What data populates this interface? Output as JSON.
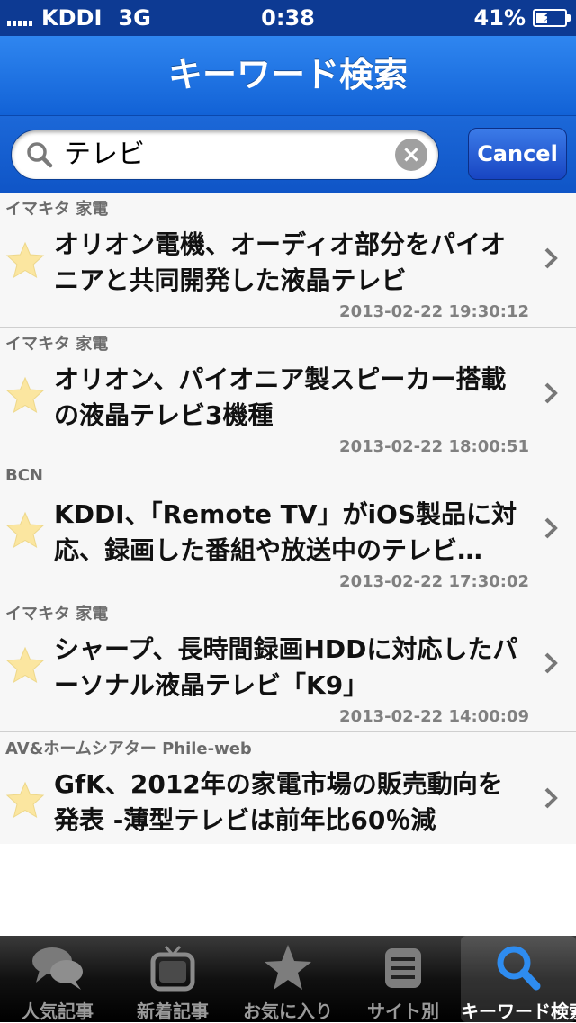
{
  "status": {
    "carrier": "KDDI",
    "network": "3G",
    "time": "0:38",
    "battery": "41%",
    "battery_level": 0.41
  },
  "nav": {
    "title": "キーワード検索"
  },
  "search": {
    "value": "テレビ",
    "cancel_label": "Cancel"
  },
  "articles": [
    {
      "source": "イマキタ 家電",
      "title": "オリオン電機、オーディオ部分をパイオニアと共同開発した液晶テレビ",
      "date": "2013-02-22 19:30:12"
    },
    {
      "source": "イマキタ 家電",
      "title": "オリオン、パイオニア製スピーカー搭載の液晶テレビ3機種",
      "date": "2013-02-22 18:00:51"
    },
    {
      "source": "BCN",
      "title": "KDDI、「Remote TV」がiOS製品に対応、録画した番組や放送中のテレビ…",
      "date": "2013-02-22 17:30:02"
    },
    {
      "source": "イマキタ 家電",
      "title": "シャープ、長時間録画HDDに対応したパーソナル液晶テレビ「K9」",
      "date": "2013-02-22 14:00:09"
    },
    {
      "source": "AV&ホームシアター Phile-web",
      "title": "GfK、2012年の家電市場の販売動向を発表 -薄型テレビは前年比60％減",
      "date": ""
    }
  ],
  "tabs": [
    {
      "label": "人気記事",
      "icon": "speech-bubbles-icon"
    },
    {
      "label": "新着記事",
      "icon": "tv-icon"
    },
    {
      "label": "お気に入り",
      "icon": "star-icon"
    },
    {
      "label": "サイト別",
      "icon": "list-icon"
    },
    {
      "label": "キーワード検索",
      "icon": "magnifier-icon",
      "active": true
    }
  ],
  "colors": {
    "nav_blue": "#1a6ee6",
    "status_bg": "#0d3a93",
    "tabbar_bg": "#111111",
    "star": "#fbe6a0"
  }
}
